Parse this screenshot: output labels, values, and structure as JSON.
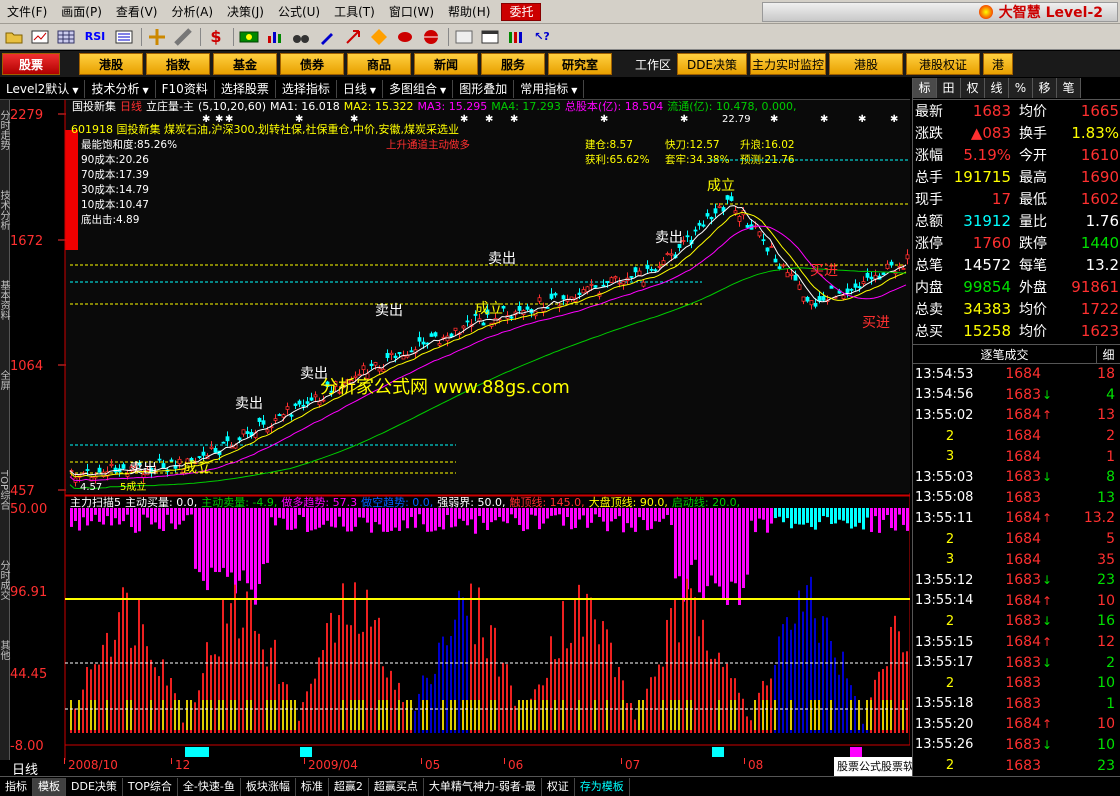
{
  "menubar": {
    "items": [
      "文件(F)",
      "画面(P)",
      "查看(V)",
      "分析(A)",
      "决策(J)",
      "公式(U)",
      "工具(T)",
      "窗口(W)",
      "帮助(H)"
    ],
    "hot": "委托",
    "brand": "大智慧 Level-2"
  },
  "toolbar": {
    "icons": [
      "folder-icon",
      "chart-icon",
      "grid-icon",
      "rsi-icon",
      "list-icon",
      "crosshair-icon",
      "ruler-icon",
      "dollar-icon",
      "money-icon",
      "bars-icon",
      "binoculars-icon",
      "pen-icon",
      "arrow-icon",
      "diamond-icon",
      "shape-icon",
      "globe-icon",
      "window-icon",
      "calendar-icon",
      "stack-icon",
      "help-icon"
    ],
    "rsi_label": "RSI"
  },
  "navbar": {
    "buttons": [
      "股票",
      "港股",
      "指数",
      "基金",
      "债券",
      "商品",
      "新闻",
      "服务",
      "研究室"
    ],
    "workspace_label": "工作区",
    "small_buttons": [
      "DDE决策",
      "主力实时监控",
      "港股",
      "港股权证",
      "港"
    ]
  },
  "subbar": {
    "items": [
      {
        "label": "Level2默认",
        "arrow": true
      },
      {
        "label": "技术分析",
        "arrow": true
      },
      {
        "label": "F10资料",
        "arrow": false
      },
      {
        "label": "选择股票",
        "arrow": false
      },
      {
        "label": "选择指标",
        "arrow": false
      },
      {
        "label": "日线",
        "arrow": true
      },
      {
        "label": "多图组合",
        "arrow": true
      },
      {
        "label": "图形叠加",
        "arrow": false
      },
      {
        "label": "常用指标",
        "arrow": true
      }
    ]
  },
  "lefttabs": [
    "分时走势",
    "技术分析",
    "基本资料",
    "全屏",
    "TOP综合",
    "分时成交",
    "其他"
  ],
  "chart": {
    "header": {
      "name": "国投新集",
      "period": "日线",
      "indicator": "立庄量-主",
      "params": "(5,10,20,60)",
      "ma1": "MA1: 16.018",
      "ma2": "MA2: 15.322",
      "ma3": "MA3: 15.295",
      "ma4": "MA4: 17.293",
      "total_shares": "总股本(亿): 18.504",
      "float_shares": "流通(亿): 10.478, 0.000,"
    },
    "info_line": "601918 国投新集 煤炭石油,沪深300,划转社保,社保重仓,中价,安徽,煤炭采选业",
    "left_stats": [
      "最能饱和度:85.26%",
      "90成本:20.26",
      "70成本:17.39",
      "30成本:14.79",
      "10成本:10.47",
      "底出击:4.89"
    ],
    "trend_note": "上升通道主动做多",
    "right_stats": {
      "jiancang": "建仓:8.57",
      "huoli": "获利:65.62%",
      "kuaidao": "快刀:12.57",
      "taolao": "套牢:34.38%",
      "shengyuan": "升浪:16.02",
      "yuce": "预测:21.76"
    },
    "price_ticks": [
      "2279",
      "1672",
      "1064",
      "457"
    ],
    "watermark": "分析家公式网 www.88gs.com",
    "signals": {
      "sell": "卖出",
      "buy": "买进",
      "stand": "成立"
    },
    "peak_label": "22.79",
    "low_label": "4.57",
    "wl_label": "5成立",
    "indicator_header": {
      "name": "主力扫描5",
      "zhudong_mai": "主动买量: 0.0,",
      "zhudong_mai2": "主动卖量: -4.9,",
      "zuoduo": "做多趋势: 57.3",
      "zuokong": "做空趋势: 0.0,",
      "qiangruo": "强弱界: 50.0,",
      "chuding": "触顶线: 145.0,",
      "dapan": "大盘顶线: 90.0,",
      "qidong": "启动线: 20.0,"
    },
    "indicator_ticks": [
      "50.00",
      "96.91",
      "44.45",
      "-8.00"
    ]
  },
  "timeaxis": {
    "labels": [
      "2008/10",
      "12",
      "2009/04",
      "05",
      "06",
      "07",
      "08"
    ],
    "period": "日线"
  },
  "quote": {
    "tabs": [
      "标",
      "田",
      "权",
      "线",
      "%",
      "移",
      "笔"
    ],
    "rows": [
      {
        "l1": "最新",
        "v1": "1683",
        "c1": "red",
        "l2": "均价",
        "v2": "1665",
        "c2": "red"
      },
      {
        "l1": "涨跌",
        "v1": "▲083",
        "c1": "red",
        "l2": "换手",
        "v2": "1.83%",
        "c2": "yellow"
      },
      {
        "l1": "涨幅",
        "v1": "5.19%",
        "c1": "red",
        "l2": "今开",
        "v2": "1610",
        "c2": "red"
      },
      {
        "l1": "总手",
        "v1": "191715",
        "c1": "yellow",
        "l2": "最高",
        "v2": "1690",
        "c2": "red"
      },
      {
        "l1": "现手",
        "v1": "17",
        "c1": "red",
        "l2": "最低",
        "v2": "1602",
        "c2": "red"
      },
      {
        "l1": "总额",
        "v1": "31912",
        "c1": "cyan",
        "l2": "量比",
        "v2": "1.76",
        "c2": "white"
      },
      {
        "l1": "涨停",
        "v1": "1760",
        "c1": "red",
        "l2": "跌停",
        "v2": "1440",
        "c2": "green"
      },
      {
        "l1": "总笔",
        "v1": "14572",
        "c1": "white",
        "l2": "每笔",
        "v2": "13.2",
        "c2": "white"
      },
      {
        "l1": "内盘",
        "v1": "99854",
        "c1": "green",
        "l2": "外盘",
        "v2": "91861",
        "c2": "red"
      },
      {
        "l1": "总卖",
        "v1": "34383",
        "c1": "yellow",
        "l2": "均价",
        "v2": "1722",
        "c2": "red"
      },
      {
        "l1": "总买",
        "v1": "15258",
        "c1": "yellow",
        "l2": "均价",
        "v2": "1623",
        "c2": "red"
      }
    ],
    "tick_title": "逐笔成交",
    "tick_tab": "细",
    "ticks": [
      {
        "time": "13:54:53",
        "price": "1684",
        "arrow": "",
        "vol": "18",
        "vc": "red"
      },
      {
        "time": "13:54:56",
        "price": "1683",
        "arrow": "↓",
        "vol": "4",
        "vc": "green"
      },
      {
        "time": "13:55:02",
        "price": "1684",
        "arrow": "↑",
        "vol": "13",
        "vc": "red"
      },
      {
        "time": "2",
        "price": "1684",
        "arrow": "",
        "vol": "2",
        "vc": "red"
      },
      {
        "time": "3",
        "price": "1684",
        "arrow": "",
        "vol": "1",
        "vc": "red"
      },
      {
        "time": "13:55:03",
        "price": "1683",
        "arrow": "↓",
        "vol": "8",
        "vc": "green"
      },
      {
        "time": "13:55:08",
        "price": "1683",
        "arrow": "",
        "vol": "13",
        "vc": "green"
      },
      {
        "time": "13:55:11",
        "price": "1684",
        "arrow": "↑",
        "vol": "13.2",
        "vc": "red"
      },
      {
        "time": "2",
        "price": "1684",
        "arrow": "",
        "vol": "5",
        "vc": "red"
      },
      {
        "time": "3",
        "price": "1684",
        "arrow": "",
        "vol": "35",
        "vc": "red"
      },
      {
        "time": "13:55:12",
        "price": "1683",
        "arrow": "↓",
        "vol": "23",
        "vc": "green"
      },
      {
        "time": "13:55:14",
        "price": "1684",
        "arrow": "↑",
        "vol": "10",
        "vc": "red"
      },
      {
        "time": "2",
        "price": "1683",
        "arrow": "↓",
        "vol": "16",
        "vc": "green"
      },
      {
        "time": "13:55:15",
        "price": "1684",
        "arrow": "↑",
        "vol": "12",
        "vc": "red"
      },
      {
        "time": "13:55:17",
        "price": "1683",
        "arrow": "↓",
        "vol": "2",
        "vc": "green"
      },
      {
        "time": "2",
        "price": "1683",
        "arrow": "",
        "vol": "10",
        "vc": "green"
      },
      {
        "time": "13:55:18",
        "price": "1683",
        "arrow": "",
        "vol": "1",
        "vc": "green"
      },
      {
        "time": "13:55:20",
        "price": "1684",
        "arrow": "↑",
        "vol": "10",
        "vc": "red"
      },
      {
        "time": "13:55:26",
        "price": "1683",
        "arrow": "↓",
        "vol": "10",
        "vc": "green"
      },
      {
        "time": "2",
        "price": "1683",
        "arrow": "",
        "vol": "23",
        "vc": "green"
      }
    ]
  },
  "bottombar": {
    "tabs": [
      "指标",
      "模板",
      "DDE决策",
      "TOP综合",
      "全-快速-鱼",
      "板块涨幅",
      "标准",
      "超赢2",
      "超赢买点",
      "大单精气神力-弱者-最",
      "权证",
      "存为模板"
    ],
    "active": "模板",
    "ad": "股票公式股票软件下载[分析家公式网www.88gs.com"
  },
  "colors": {
    "up": "#ff3030",
    "down": "#00ffff",
    "magenta": "#ff00ff",
    "yellow": "#ffff00",
    "green": "#00cc00",
    "blue": "#0000cc"
  }
}
